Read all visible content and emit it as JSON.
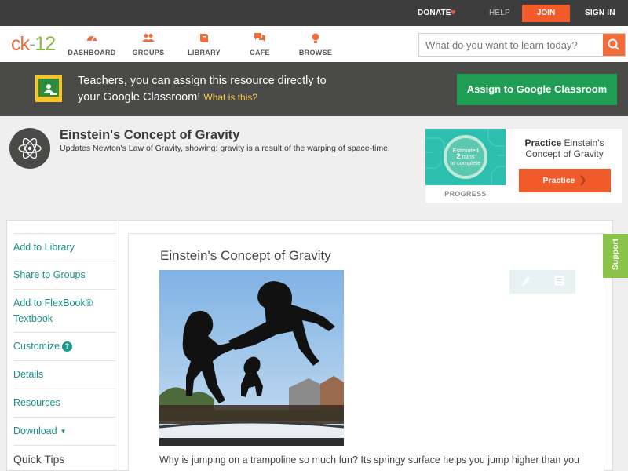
{
  "topbar": {
    "donate": "DONATE",
    "help": "HELP",
    "join": "JOIN",
    "signin": "SIGN IN"
  },
  "logo": {
    "ck": "ck",
    "dash": "-",
    "num": "12"
  },
  "nav": [
    {
      "label": "DASHBOARD",
      "icon": "dashboard-icon"
    },
    {
      "label": "GROUPS",
      "icon": "groups-icon"
    },
    {
      "label": "LIBRARY",
      "icon": "library-icon"
    },
    {
      "label": "CAFE",
      "icon": "cafe-icon"
    },
    {
      "label": "BROWSE",
      "icon": "browse-icon"
    }
  ],
  "search": {
    "placeholder": "What do you want to learn today?"
  },
  "classroom_banner": {
    "line1": "Teachers, you can assign this resource directly to",
    "line2": "your Google Classroom!",
    "what": "What is this?",
    "assign_label": "Assign to Google Classroom"
  },
  "concept": {
    "title": "Einstein's Concept of Gravity",
    "subtitle": "Updates Newton's Law of Gravity, showing: gravity is a result of the warping of space-time."
  },
  "practice": {
    "ring_line1": "Estimated",
    "ring_minutes": "2",
    "ring_unit": "mins",
    "ring_line3": "to complete",
    "progress_label": "PROGRESS",
    "heading_bold": "Practice",
    "heading_rest": "Einstein's Concept of Gravity",
    "button_label": "Practice"
  },
  "sidebar": {
    "items": [
      {
        "label": "Add to Library"
      },
      {
        "label": "Share to Groups"
      },
      {
        "label": "Add to FlexBook® Textbook"
      },
      {
        "label": "Customize"
      },
      {
        "label": "Details"
      },
      {
        "label": "Resources"
      },
      {
        "label": "Download"
      }
    ],
    "quick_tips": "Quick Tips"
  },
  "main": {
    "title": "Einstein's Concept of Gravity",
    "paragraph": "Why is jumping on a trampoline so much fun? Its springy surface helps you jump higher than you"
  },
  "support_label": "Support",
  "colors": {
    "accent": "#f15a29",
    "teal": "#1a8f8a",
    "classroom_green": "#1f9d55",
    "support_green": "#8bc34a"
  }
}
